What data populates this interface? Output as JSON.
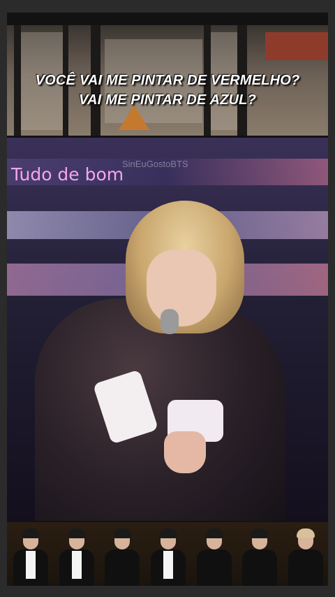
{
  "top_panel": {
    "subtitle_line1": "VOCÊ VAI ME PINTAR DE VERMELHO?",
    "subtitle_line2": "VAI ME PINTAR DE AZUL?"
  },
  "main_panel": {
    "caption": "Tudo de bom",
    "watermark": "SinEuGostoBTS"
  },
  "bottom_panel": {
    "people": [
      {
        "name": "member-1",
        "hair": "#1a1a1a",
        "shirt": "#f4f4f4"
      },
      {
        "name": "member-2",
        "hair": "#1a1a1a",
        "shirt": "#f4f4f4"
      },
      {
        "name": "member-3",
        "hair": "#1a1a1a",
        "shirt": "#101010"
      },
      {
        "name": "member-4",
        "hair": "#1a1a1a",
        "shirt": "#f4f4f4"
      },
      {
        "name": "member-5",
        "hair": "#1a1a1a",
        "shirt": "#101010"
      },
      {
        "name": "member-6",
        "hair": "#1a1a1a",
        "shirt": "#101010"
      },
      {
        "name": "member-7",
        "hair": "#d8c09a",
        "shirt": "#101010"
      }
    ]
  },
  "colors": {
    "caption": "#f6a5ef",
    "background": "#2b2b2b"
  }
}
